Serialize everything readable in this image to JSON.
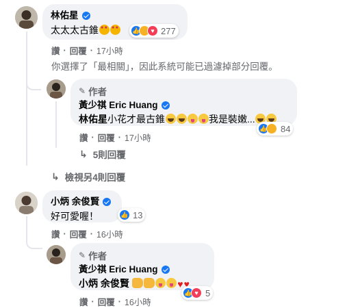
{
  "comment1": {
    "author": "林佑星",
    "text": "太太太古錐",
    "reaction_count": "277",
    "actions": {
      "like": "讚",
      "reply": "回覆",
      "sep": "·",
      "time": "17小時"
    },
    "filter_notice": "你選擇了「最相關」，因此系統可能已過濾掉部分回覆。",
    "reply": {
      "author_tag": "作者",
      "author": "黃少祺 Eric Huang",
      "mention": "林佑星",
      "text_a": "小花才最古錐",
      "text_b": "我是裝嫩...",
      "reaction_count": "84",
      "actions": {
        "like": "讚",
        "reply": "回覆",
        "sep": "·",
        "time": "17小時"
      },
      "more_replies": "5則回覆"
    },
    "view_more": "檢視另4則回覆"
  },
  "comment2": {
    "author": "小炳 余俊賢",
    "text": "好可愛喔！",
    "reaction_count": "13",
    "actions": {
      "like": "讚",
      "reply": "回覆",
      "sep": "·",
      "time": "16小時"
    },
    "reply": {
      "author_tag": "作者",
      "author": "黃少祺 Eric Huang",
      "mention": "小炳 余俊賢",
      "reaction_count": "5",
      "actions": {
        "like": "讚",
        "reply": "回覆",
        "sep": "·",
        "time": "16小時"
      }
    }
  },
  "colors": {
    "accent": "#1877f2",
    "bubble": "#f0f2f5",
    "secondary_text": "#65676b"
  }
}
